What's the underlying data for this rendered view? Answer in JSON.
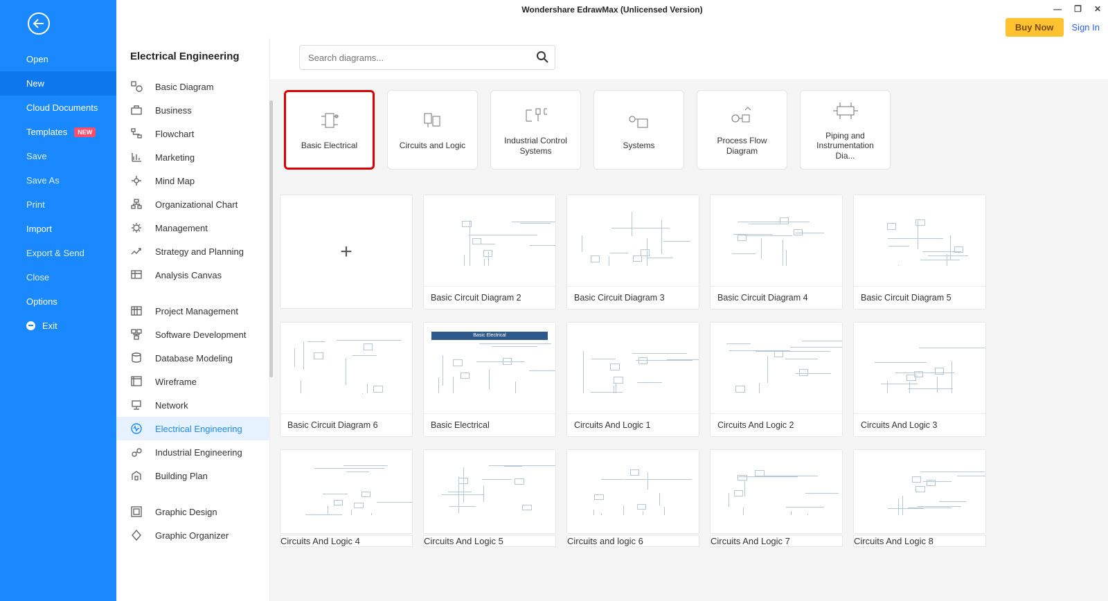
{
  "window": {
    "title": "Wondershare EdrawMax (Unlicensed Version)"
  },
  "topActions": {
    "buyNow": "Buy Now",
    "signIn": "Sign In"
  },
  "leftMenu": {
    "open": "Open",
    "new": "New",
    "cloudDocs": "Cloud Documents",
    "templates": "Templates",
    "templatesBadge": "NEW",
    "save": "Save",
    "saveAs": "Save As",
    "print": "Print",
    "import": "Import",
    "exportSend": "Export & Send",
    "close": "Close",
    "options": "Options",
    "exit": "Exit"
  },
  "categoriesTitle": "Electrical Engineering",
  "categories": [
    {
      "label": "Basic Diagram",
      "icon": "shapes"
    },
    {
      "label": "Business",
      "icon": "briefcase"
    },
    {
      "label": "Flowchart",
      "icon": "flow"
    },
    {
      "label": "Marketing",
      "icon": "chart"
    },
    {
      "label": "Mind Map",
      "icon": "mind"
    },
    {
      "label": "Organizational Chart",
      "icon": "org"
    },
    {
      "label": "Management",
      "icon": "mgmt"
    },
    {
      "label": "Strategy and Planning",
      "icon": "strategy"
    },
    {
      "label": "Analysis Canvas",
      "icon": "canvas"
    },
    {
      "label": "Project Management",
      "icon": "project",
      "sepBefore": true
    },
    {
      "label": "Software Development",
      "icon": "soft"
    },
    {
      "label": "Database Modeling",
      "icon": "db"
    },
    {
      "label": "Wireframe",
      "icon": "wire"
    },
    {
      "label": "Network",
      "icon": "net"
    },
    {
      "label": "Electrical Engineering",
      "icon": "ee",
      "active": true
    },
    {
      "label": "Industrial Engineering",
      "icon": "ind"
    },
    {
      "label": "Building Plan",
      "icon": "build"
    },
    {
      "label": "Graphic Design",
      "icon": "gd",
      "sepBefore": true
    },
    {
      "label": "Graphic Organizer",
      "icon": "go"
    }
  ],
  "search": {
    "placeholder": "Search diagrams..."
  },
  "subtypes": [
    {
      "label": "Basic Electrical",
      "selected": true
    },
    {
      "label": "Circuits and Logic"
    },
    {
      "label": "Industrial Control Systems"
    },
    {
      "label": "Systems"
    },
    {
      "label": "Process Flow Diagram"
    },
    {
      "label": "Piping and Instrumentation Dia..."
    }
  ],
  "templates": {
    "row1": [
      {
        "blank": true
      },
      {
        "caption": "Basic Circuit Diagram 2"
      },
      {
        "caption": "Basic Circuit Diagram 3"
      },
      {
        "caption": "Basic Circuit Diagram 4"
      },
      {
        "caption": "Basic Circuit Diagram 5"
      }
    ],
    "row2": [
      {
        "caption": "Basic Circuit Diagram 6"
      },
      {
        "caption": "Basic Electrical",
        "bluebar": "Basic Electrical"
      },
      {
        "caption": "Circuits And Logic 1"
      },
      {
        "caption": "Circuits And Logic 2"
      },
      {
        "caption": "Circuits And Logic 3"
      }
    ],
    "row3": [
      {
        "caption": "Circuits And Logic 4"
      },
      {
        "caption": "Circuits And Logic 5"
      },
      {
        "caption": "Circuits and logic 6"
      },
      {
        "caption": "Circuits And Logic 7"
      },
      {
        "caption": "Circuits And Logic 8"
      }
    ]
  }
}
